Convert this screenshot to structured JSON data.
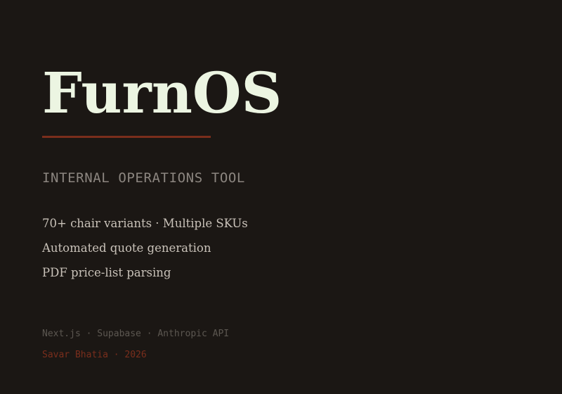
{
  "hero": {
    "title": "FurnOS",
    "subtitle": "INTERNAL OPERATIONS TOOL"
  },
  "features": [
    "70+ chair variants · Multiple SKUs",
    "Automated quote generation",
    "PDF price-list parsing"
  ],
  "footer": {
    "stack": "Next.js · Supabase · Anthropic API",
    "credit": "Savar Bhatia · 2026"
  },
  "colors": {
    "background": "#1b1714",
    "title": "#ecf5e2",
    "accent": "#7a2e1c",
    "subtitle": "#8c8680",
    "body": "#c9c2b9",
    "muted": "#5c5751"
  }
}
